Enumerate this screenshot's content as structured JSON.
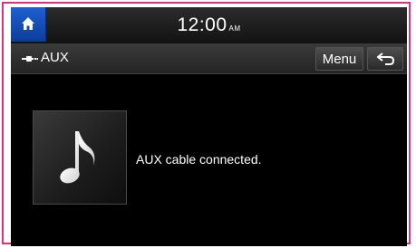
{
  "status_bar": {
    "time": "12:00",
    "ampm": "AM"
  },
  "title_bar": {
    "source_label": "AUX",
    "menu_label": "Menu"
  },
  "content": {
    "status_message": "AUX cable connected."
  },
  "colors": {
    "frame_border": "#e0307f",
    "home_button": "#1f5fd0",
    "background": "#000000"
  },
  "icons": {
    "home": "home-icon",
    "source": "aux-cable-icon",
    "back": "back-arrow-icon",
    "album": "music-note-icon"
  }
}
